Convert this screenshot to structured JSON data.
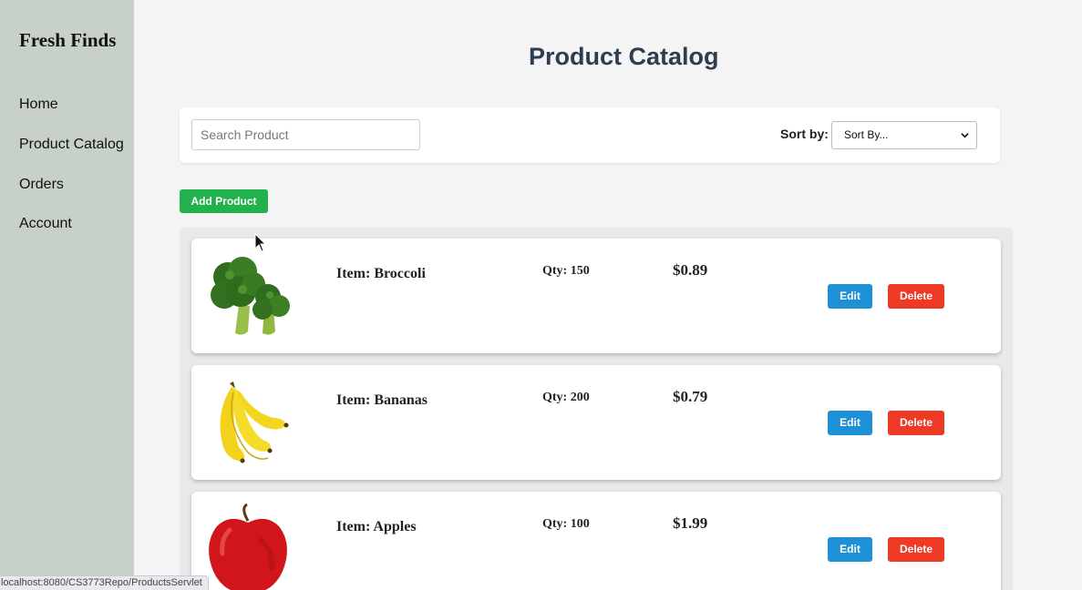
{
  "sidebar": {
    "brand": "Fresh Finds",
    "items": [
      {
        "label": "Home"
      },
      {
        "label": "Product Catalog"
      },
      {
        "label": "Orders"
      },
      {
        "label": "Account"
      }
    ]
  },
  "main": {
    "title": "Product Catalog",
    "search": {
      "placeholder": "Search Product",
      "value": ""
    },
    "sort": {
      "label": "Sort by:",
      "selected": "Sort By..."
    },
    "add_button": "Add Product",
    "products": [
      {
        "name": "Item: Broccoli",
        "qty": "Qty: 150",
        "price": "$0.89",
        "edit": "Edit",
        "delete": "Delete",
        "image_icon": "broccoli-image"
      },
      {
        "name": "Item: Bananas",
        "qty": "Qty: 200",
        "price": "$0.79",
        "edit": "Edit",
        "delete": "Delete",
        "image_icon": "bananas-image"
      },
      {
        "name": "Item: Apples",
        "qty": "Qty: 100",
        "price": "$1.99",
        "edit": "Edit",
        "delete": "Delete",
        "image_icon": "apple-image"
      }
    ]
  },
  "status_bar": {
    "url": "localhost:8080/CS3773Repo/ProductsServlet"
  },
  "colors": {
    "sidebar_bg": "#c8d0ca",
    "title": "#2c3e50",
    "add_button": "#22b14c",
    "edit_button": "#1e90d6",
    "delete_button": "#ee3a24"
  }
}
